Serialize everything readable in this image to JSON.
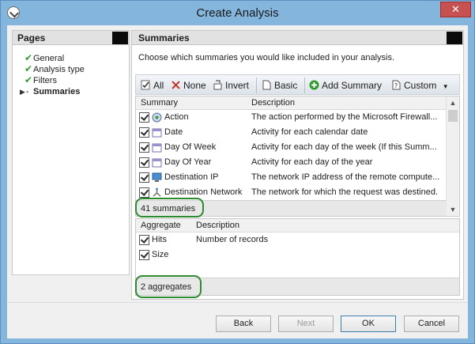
{
  "window": {
    "title": "Create Analysis",
    "close_glyph": "✕"
  },
  "pages": {
    "header": "Pages",
    "items": [
      {
        "label": "General",
        "done": true
      },
      {
        "label": "Analysis type",
        "done": true
      },
      {
        "label": "Filters",
        "done": true
      },
      {
        "label": "Summaries",
        "active": true
      }
    ]
  },
  "summaries": {
    "header": "Summaries",
    "intro": "Choose which summaries you would like included in your analysis.",
    "toolbar": {
      "all": "All",
      "none": "None",
      "invert": "Invert",
      "basic": "Basic",
      "add_summary": "Add Summary",
      "custom": "Custom"
    },
    "columns": {
      "summary": "Summary",
      "description": "Description"
    },
    "rows": [
      {
        "name": "Action",
        "description": "The action performed by the Microsoft Firewall...",
        "icon": "action-icon"
      },
      {
        "name": "Date",
        "description": "Activity for each calendar date",
        "icon": "calendar-icon"
      },
      {
        "name": "Day Of Week",
        "description": "Activity for each day of the week (If this Summ...",
        "icon": "calendar-icon"
      },
      {
        "name": "Day Of Year",
        "description": "Activity for each day of the year",
        "icon": "calendar-icon"
      },
      {
        "name": "Destination IP",
        "description": "The network IP address of the remote compute...",
        "icon": "computer-icon"
      },
      {
        "name": "Destination Network",
        "description": "The network for which the request was destined.",
        "icon": "network-icon"
      }
    ],
    "count_label": "41 summaries"
  },
  "aggregates": {
    "columns": {
      "aggregate": "Aggregate",
      "description": "Description"
    },
    "rows": [
      {
        "name": "Hits",
        "description": "Number of records"
      },
      {
        "name": "Size",
        "description": ""
      }
    ],
    "count_label": "2 aggregates"
  },
  "buttons": {
    "back": "Back",
    "next": "Next",
    "ok": "OK",
    "cancel": "Cancel"
  },
  "colors": {
    "highlight": "#2e8a2e",
    "check": "#2e9a2e",
    "close": "#c75050"
  }
}
